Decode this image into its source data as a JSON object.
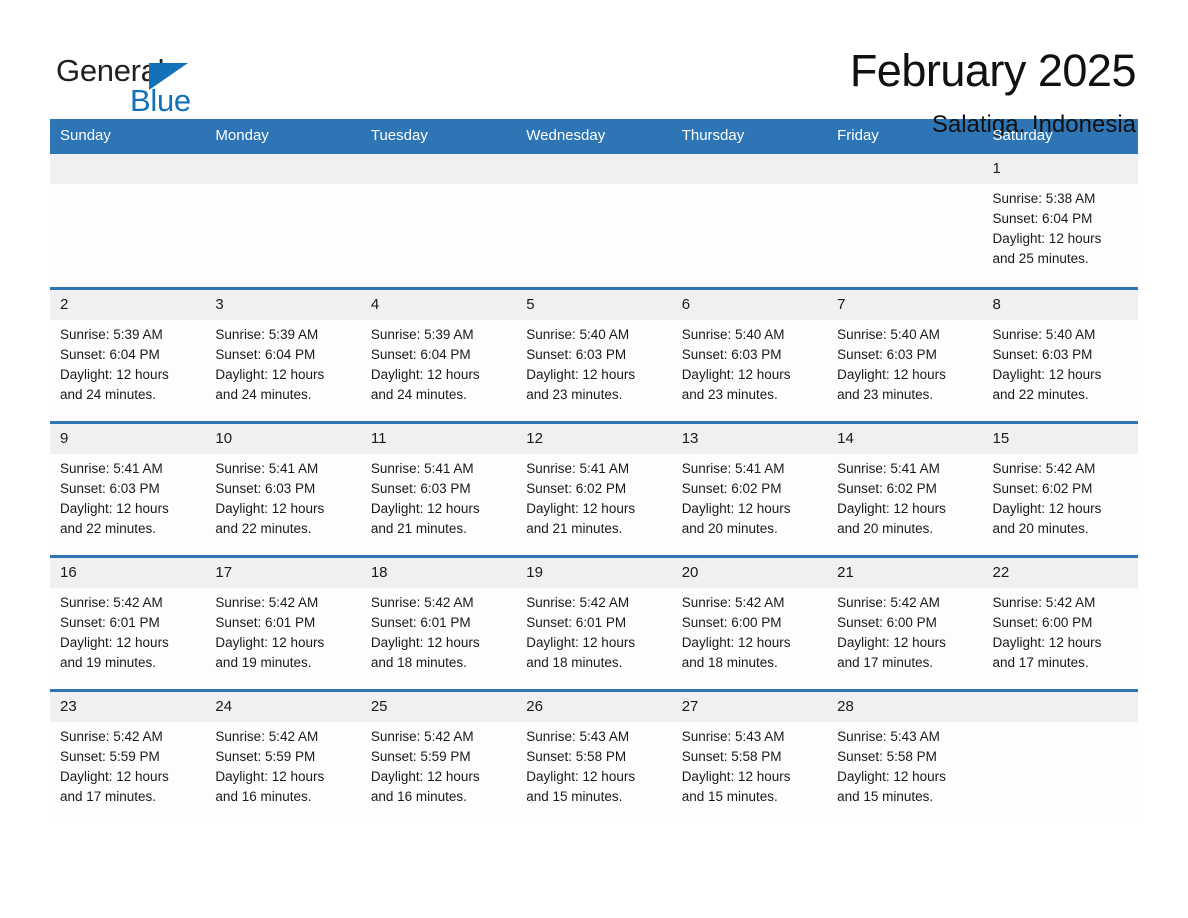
{
  "brand": {
    "logo_word_1": "General",
    "logo_word_2": "Blue",
    "logo_triangle_icon": "triangle-icon",
    "accent_color": "#1271b8"
  },
  "header": {
    "title": "February 2025",
    "location": "Salatiga, Indonesia"
  },
  "calendar": {
    "header_color": "#2e75b6",
    "date_band_color": "#f0f0f0",
    "weekday_headers": [
      "Sunday",
      "Monday",
      "Tuesday",
      "Wednesday",
      "Thursday",
      "Friday",
      "Saturday"
    ],
    "weeks": [
      [
        {
          "empty": true
        },
        {
          "empty": true
        },
        {
          "empty": true
        },
        {
          "empty": true
        },
        {
          "empty": true
        },
        {
          "empty": true
        },
        {
          "day": "1",
          "sunrise": "Sunrise: 5:38 AM",
          "sunset": "Sunset: 6:04 PM",
          "daylight_line1": "Daylight: 12 hours",
          "daylight_line2": "and 25 minutes."
        }
      ],
      [
        {
          "day": "2",
          "sunrise": "Sunrise: 5:39 AM",
          "sunset": "Sunset: 6:04 PM",
          "daylight_line1": "Daylight: 12 hours",
          "daylight_line2": "and 24 minutes."
        },
        {
          "day": "3",
          "sunrise": "Sunrise: 5:39 AM",
          "sunset": "Sunset: 6:04 PM",
          "daylight_line1": "Daylight: 12 hours",
          "daylight_line2": "and 24 minutes."
        },
        {
          "day": "4",
          "sunrise": "Sunrise: 5:39 AM",
          "sunset": "Sunset: 6:04 PM",
          "daylight_line1": "Daylight: 12 hours",
          "daylight_line2": "and 24 minutes."
        },
        {
          "day": "5",
          "sunrise": "Sunrise: 5:40 AM",
          "sunset": "Sunset: 6:03 PM",
          "daylight_line1": "Daylight: 12 hours",
          "daylight_line2": "and 23 minutes."
        },
        {
          "day": "6",
          "sunrise": "Sunrise: 5:40 AM",
          "sunset": "Sunset: 6:03 PM",
          "daylight_line1": "Daylight: 12 hours",
          "daylight_line2": "and 23 minutes."
        },
        {
          "day": "7",
          "sunrise": "Sunrise: 5:40 AM",
          "sunset": "Sunset: 6:03 PM",
          "daylight_line1": "Daylight: 12 hours",
          "daylight_line2": "and 23 minutes."
        },
        {
          "day": "8",
          "sunrise": "Sunrise: 5:40 AM",
          "sunset": "Sunset: 6:03 PM",
          "daylight_line1": "Daylight: 12 hours",
          "daylight_line2": "and 22 minutes."
        }
      ],
      [
        {
          "day": "9",
          "sunrise": "Sunrise: 5:41 AM",
          "sunset": "Sunset: 6:03 PM",
          "daylight_line1": "Daylight: 12 hours",
          "daylight_line2": "and 22 minutes."
        },
        {
          "day": "10",
          "sunrise": "Sunrise: 5:41 AM",
          "sunset": "Sunset: 6:03 PM",
          "daylight_line1": "Daylight: 12 hours",
          "daylight_line2": "and 22 minutes."
        },
        {
          "day": "11",
          "sunrise": "Sunrise: 5:41 AM",
          "sunset": "Sunset: 6:03 PM",
          "daylight_line1": "Daylight: 12 hours",
          "daylight_line2": "and 21 minutes."
        },
        {
          "day": "12",
          "sunrise": "Sunrise: 5:41 AM",
          "sunset": "Sunset: 6:02 PM",
          "daylight_line1": "Daylight: 12 hours",
          "daylight_line2": "and 21 minutes."
        },
        {
          "day": "13",
          "sunrise": "Sunrise: 5:41 AM",
          "sunset": "Sunset: 6:02 PM",
          "daylight_line1": "Daylight: 12 hours",
          "daylight_line2": "and 20 minutes."
        },
        {
          "day": "14",
          "sunrise": "Sunrise: 5:41 AM",
          "sunset": "Sunset: 6:02 PM",
          "daylight_line1": "Daylight: 12 hours",
          "daylight_line2": "and 20 minutes."
        },
        {
          "day": "15",
          "sunrise": "Sunrise: 5:42 AM",
          "sunset": "Sunset: 6:02 PM",
          "daylight_line1": "Daylight: 12 hours",
          "daylight_line2": "and 20 minutes."
        }
      ],
      [
        {
          "day": "16",
          "sunrise": "Sunrise: 5:42 AM",
          "sunset": "Sunset: 6:01 PM",
          "daylight_line1": "Daylight: 12 hours",
          "daylight_line2": "and 19 minutes."
        },
        {
          "day": "17",
          "sunrise": "Sunrise: 5:42 AM",
          "sunset": "Sunset: 6:01 PM",
          "daylight_line1": "Daylight: 12 hours",
          "daylight_line2": "and 19 minutes."
        },
        {
          "day": "18",
          "sunrise": "Sunrise: 5:42 AM",
          "sunset": "Sunset: 6:01 PM",
          "daylight_line1": "Daylight: 12 hours",
          "daylight_line2": "and 18 minutes."
        },
        {
          "day": "19",
          "sunrise": "Sunrise: 5:42 AM",
          "sunset": "Sunset: 6:01 PM",
          "daylight_line1": "Daylight: 12 hours",
          "daylight_line2": "and 18 minutes."
        },
        {
          "day": "20",
          "sunrise": "Sunrise: 5:42 AM",
          "sunset": "Sunset: 6:00 PM",
          "daylight_line1": "Daylight: 12 hours",
          "daylight_line2": "and 18 minutes."
        },
        {
          "day": "21",
          "sunrise": "Sunrise: 5:42 AM",
          "sunset": "Sunset: 6:00 PM",
          "daylight_line1": "Daylight: 12 hours",
          "daylight_line2": "and 17 minutes."
        },
        {
          "day": "22",
          "sunrise": "Sunrise: 5:42 AM",
          "sunset": "Sunset: 6:00 PM",
          "daylight_line1": "Daylight: 12 hours",
          "daylight_line2": "and 17 minutes."
        }
      ],
      [
        {
          "day": "23",
          "sunrise": "Sunrise: 5:42 AM",
          "sunset": "Sunset: 5:59 PM",
          "daylight_line1": "Daylight: 12 hours",
          "daylight_line2": "and 17 minutes."
        },
        {
          "day": "24",
          "sunrise": "Sunrise: 5:42 AM",
          "sunset": "Sunset: 5:59 PM",
          "daylight_line1": "Daylight: 12 hours",
          "daylight_line2": "and 16 minutes."
        },
        {
          "day": "25",
          "sunrise": "Sunrise: 5:42 AM",
          "sunset": "Sunset: 5:59 PM",
          "daylight_line1": "Daylight: 12 hours",
          "daylight_line2": "and 16 minutes."
        },
        {
          "day": "26",
          "sunrise": "Sunrise: 5:43 AM",
          "sunset": "Sunset: 5:58 PM",
          "daylight_line1": "Daylight: 12 hours",
          "daylight_line2": "and 15 minutes."
        },
        {
          "day": "27",
          "sunrise": "Sunrise: 5:43 AM",
          "sunset": "Sunset: 5:58 PM",
          "daylight_line1": "Daylight: 12 hours",
          "daylight_line2": "and 15 minutes."
        },
        {
          "day": "28",
          "sunrise": "Sunrise: 5:43 AM",
          "sunset": "Sunset: 5:58 PM",
          "daylight_line1": "Daylight: 12 hours",
          "daylight_line2": "and 15 minutes."
        },
        {
          "empty": true
        }
      ]
    ]
  }
}
